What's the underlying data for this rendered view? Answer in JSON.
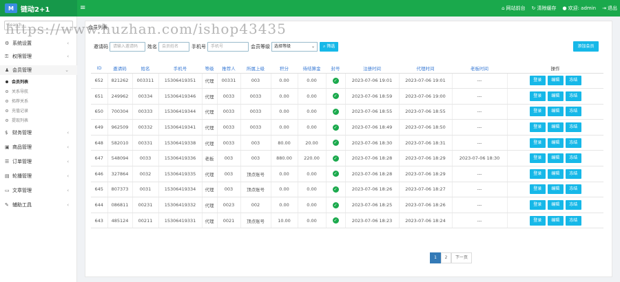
{
  "header": {
    "app_title": "链动2+1",
    "menu_icon": "hamburger-icon",
    "links": [
      {
        "label": "网站前台",
        "icon": "home-icon"
      },
      {
        "label": "清除缓存",
        "icon": "refresh-icon"
      },
      {
        "label": "欢迎: admin",
        "icon": "user-icon"
      },
      {
        "label": "退出",
        "icon": "logout-icon"
      }
    ]
  },
  "sidebar": {
    "search_placeholder": "Search...",
    "items": [
      {
        "label": "系统设置",
        "icon": "gear-icon"
      },
      {
        "label": "权限管理",
        "icon": "key-icon"
      },
      {
        "label": "会员管理",
        "icon": "user-icon"
      },
      {
        "label": "财务管理",
        "icon": "money-icon"
      },
      {
        "label": "商品管理",
        "icon": "box-icon"
      },
      {
        "label": "订单管理",
        "icon": "list-icon"
      },
      {
        "label": "轮播管理",
        "icon": "image-icon"
      },
      {
        "label": "文章管理",
        "icon": "file-icon"
      },
      {
        "label": "辅助工具",
        "icon": "wrench-icon"
      }
    ],
    "subitems": [
      "会员列表",
      "关系导航",
      "拓荐关系",
      "充值记录",
      "提现列表"
    ]
  },
  "watermark": "https://www.huzhan.com/ishop43435",
  "breadcrumb": "会员列表",
  "filters": {
    "invite_label": "邀请码",
    "invite_placeholder": "请输入邀请码",
    "name_label": "姓名",
    "name_placeholder": "会员姓名",
    "phone_label": "手机号",
    "phone_placeholder": "手机号",
    "level_label": "会员等级",
    "level_value": "选择等级",
    "search_label": "筛选",
    "add_label": "添加会员"
  },
  "table": {
    "headers": [
      "ID",
      "邀请码",
      "姓名",
      "手机号",
      "等级",
      "推荐人",
      "所属上级",
      "积分",
      "待结算金",
      "封号",
      "注册时间",
      "代理时间",
      "老板时间",
      "操作"
    ],
    "rows": [
      [
        "652",
        "821262",
        "003311",
        "15306419351",
        "代理",
        "00331",
        "003",
        "0.00",
        "0.00",
        "✓",
        "2023-07-06 19:01",
        "2023-07-06 19:01",
        "---"
      ],
      [
        "651",
        "249962",
        "00334",
        "15306419346",
        "代理",
        "0033",
        "0033",
        "0.00",
        "0.00",
        "✓",
        "2023-07-06 18:59",
        "2023-07-06 19:00",
        "---"
      ],
      [
        "650",
        "700304",
        "00333",
        "15306419344",
        "代理",
        "0033",
        "0033",
        "0.00",
        "0.00",
        "✓",
        "2023-07-06 18:55",
        "2023-07-06 18:55",
        "---"
      ],
      [
        "649",
        "962509",
        "00332",
        "15306419341",
        "代理",
        "0033",
        "0033",
        "0.00",
        "0.00",
        "✓",
        "2023-07-06 18:49",
        "2023-07-06 18:50",
        "---"
      ],
      [
        "648",
        "582010",
        "00331",
        "15306419338",
        "代理",
        "0033",
        "003",
        "80.00",
        "20.00",
        "✓",
        "2023-07-06 18:30",
        "2023-07-06 18:31",
        "---"
      ],
      [
        "647",
        "548094",
        "0033",
        "15306419336",
        "老板",
        "003",
        "003",
        "880.00",
        "220.00",
        "✓",
        "2023-07-06 18:28",
        "2023-07-06 18:29",
        "2023-07-06 18:30"
      ],
      [
        "646",
        "327864",
        "0032",
        "15306419335",
        "代理",
        "003",
        "顶点账号",
        "0.00",
        "0.00",
        "✓",
        "2023-07-06 18:28",
        "2023-07-06 18:29",
        "---"
      ],
      [
        "645",
        "807373",
        "0031",
        "15306419334",
        "代理",
        "003",
        "顶点账号",
        "0.00",
        "0.00",
        "✓",
        "2023-07-06 18:26",
        "2023-07-06 18:27",
        "---"
      ],
      [
        "644",
        "086811",
        "00231",
        "15306419332",
        "代理",
        "0023",
        "002",
        "0.00",
        "0.00",
        "✓",
        "2023-07-06 18:25",
        "2023-07-06 18:26",
        "---"
      ],
      [
        "643",
        "485124",
        "00211",
        "15306419331",
        "代理",
        "0021",
        "顶点账号",
        "10.00",
        "0.00",
        "✓",
        "2023-07-06 18:23",
        "2023-07-06 18:24",
        "---"
      ]
    ],
    "actions": [
      "登录",
      "编辑",
      "冻结"
    ],
    "ok_color": "#1aa94c",
    "action_color": "#16b8e8"
  },
  "pagination": {
    "pages": [
      "1",
      "2"
    ],
    "next": "下一页",
    "current": "1"
  },
  "colors": {
    "topbar": "#1aa94c",
    "accent": "#16b8e8"
  }
}
